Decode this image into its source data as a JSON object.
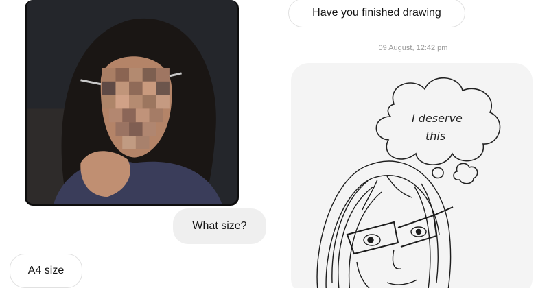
{
  "left_chat": {
    "photo_alt": "shared photo",
    "messages": [
      {
        "text": "What size?",
        "direction": "outgoing"
      },
      {
        "text": "A4 size",
        "direction": "incoming"
      }
    ]
  },
  "right_chat": {
    "messages": [
      {
        "text": "Have you finished drawing",
        "direction": "incoming"
      }
    ],
    "timestamp": "09 August, 12:42 pm",
    "drawing": {
      "thought_line1": "I deserve",
      "thought_line2": "this"
    }
  },
  "colors": {
    "outgoing_bubble": "#efefef",
    "incoming_bubble_border": "#e1e1e1",
    "timestamp": "#9a9a9a"
  }
}
